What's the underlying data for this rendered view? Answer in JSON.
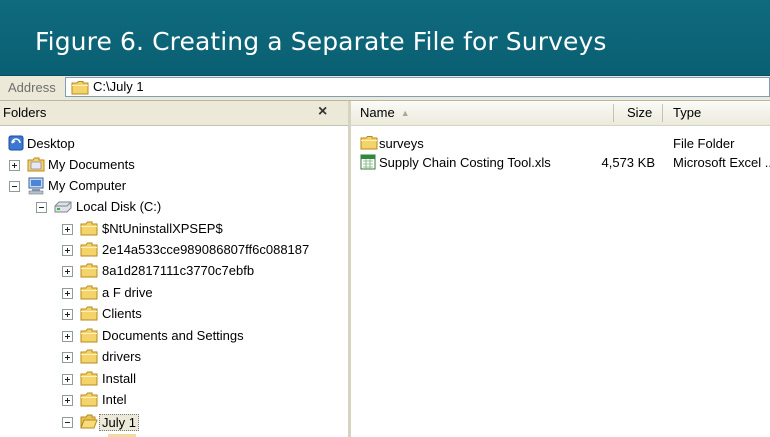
{
  "figure_title": "Figure 6. Creating a Separate File for Surveys",
  "address": {
    "label": "Address",
    "path": "C:\\July 1"
  },
  "folders_pane": {
    "title": "Folders",
    "close_symbol": "×",
    "tree": [
      {
        "label": "Desktop",
        "icon": "desktop-icon",
        "expander": "none"
      },
      {
        "label": "My Documents",
        "icon": "folder-icon",
        "expander": "plus"
      },
      {
        "label": "My Computer",
        "icon": "computer-icon",
        "expander": "minus"
      },
      {
        "label": "Local Disk (C:)",
        "icon": "drive-icon",
        "expander": "minus"
      },
      {
        "label": "$NtUninstallXPSEP$",
        "icon": "folder-icon",
        "expander": "plus"
      },
      {
        "label": "2e14a533cce989086807ff6c088187",
        "icon": "folder-icon",
        "expander": "plus"
      },
      {
        "label": "8a1d2817111c3770c7ebfb",
        "icon": "folder-icon",
        "expander": "plus"
      },
      {
        "label": "a F drive",
        "icon": "folder-icon",
        "expander": "plus"
      },
      {
        "label": "Clients",
        "icon": "folder-icon",
        "expander": "plus"
      },
      {
        "label": "Documents and Settings",
        "icon": "folder-icon",
        "expander": "plus"
      },
      {
        "label": "drivers",
        "icon": "folder-icon",
        "expander": "plus"
      },
      {
        "label": "Install",
        "icon": "folder-icon",
        "expander": "plus"
      },
      {
        "label": "Intel",
        "icon": "folder-icon",
        "expander": "plus"
      },
      {
        "label": "July 1",
        "icon": "folder-icon",
        "expander": "minus",
        "selected": true
      }
    ]
  },
  "list_pane": {
    "columns": {
      "name": "Name",
      "size": "Size",
      "type": "Type"
    },
    "rows": [
      {
        "name": "surveys",
        "size": "",
        "type": "File Folder",
        "icon": "folder-icon"
      },
      {
        "name": "Supply Chain Costing Tool.xls",
        "size": "4,573 KB",
        "type": "Microsoft Excel ...",
        "icon": "excel-file-icon"
      }
    ]
  },
  "colors": {
    "banner": "#0f6b7e",
    "toolbar": "#ece9d8",
    "folder_yellow": "#f4d36a",
    "address_border": "#7f9db9"
  }
}
